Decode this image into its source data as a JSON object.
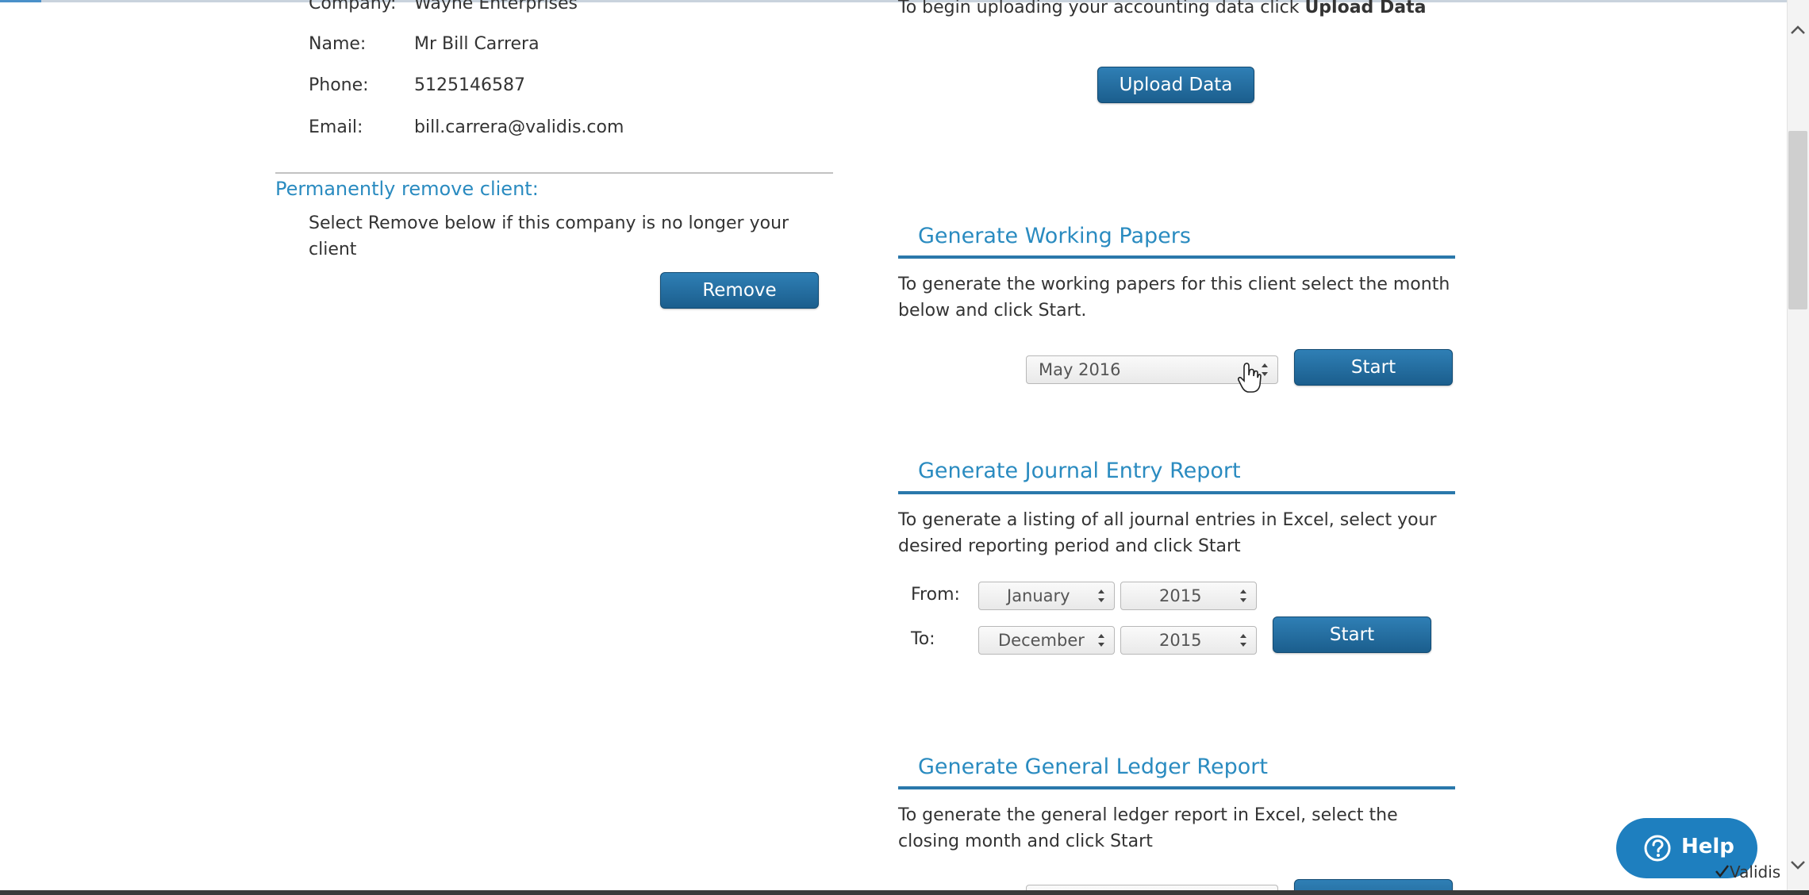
{
  "client_info": {
    "company_label": "Company:",
    "company_value": "Wayne Enterprises",
    "name_label": "Name:",
    "name_value": "Mr Bill Carrera",
    "phone_label": "Phone:",
    "phone_value": "5125146587",
    "email_label": "Email:",
    "email_value": "bill.carrera@validis.com"
  },
  "remove_client": {
    "heading": "Permanently remove client:",
    "description": "Select Remove below if this company is no longer your client",
    "button_label": "Remove"
  },
  "upload": {
    "intro_text": "To begin uploading your accounting data click ",
    "intro_bold": "Upload Data",
    "button_label": "Upload Data"
  },
  "working_papers": {
    "title": "Generate Working Papers",
    "description": "To generate the working papers for this client select the month below and click Start.",
    "month_selected": "May 2016",
    "start_label": "Start"
  },
  "journal_entry": {
    "title": "Generate Journal Entry Report",
    "description": "To generate a listing of all journal entries in Excel, select your desired reporting period and click Start",
    "from_label": "From:",
    "to_label": "To:",
    "from_month": "January",
    "from_year": "2015",
    "to_month": "December",
    "to_year": "2015",
    "start_label": "Start"
  },
  "general_ledger": {
    "title": "Generate General Ledger Report",
    "description": "To generate the general ledger report in Excel, select the closing month and click Start"
  },
  "help": {
    "label": "Help",
    "brand": "Validis"
  },
  "colors": {
    "accent": "#2a8bc0",
    "button": "#1b5e8d",
    "help": "#1e7fbf"
  }
}
